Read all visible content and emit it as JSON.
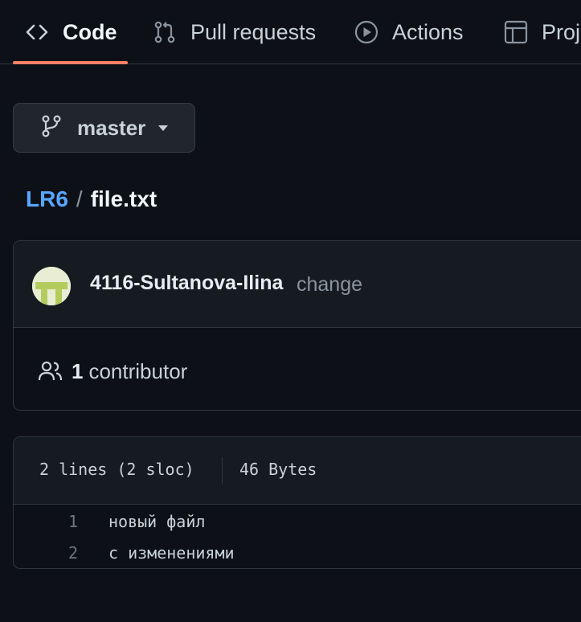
{
  "nav": {
    "tabs": [
      {
        "label": "Code",
        "icon": "code-icon",
        "active": true
      },
      {
        "label": "Pull requests",
        "icon": "pull-request-icon",
        "active": false
      },
      {
        "label": "Actions",
        "icon": "play-circle-icon",
        "active": false
      },
      {
        "label": "Proj",
        "icon": "table-icon",
        "active": false
      }
    ]
  },
  "branch": {
    "label": "master",
    "icon": "git-branch-icon"
  },
  "breadcrumb": {
    "repo": "LR6",
    "separator": "/",
    "file": "file.txt"
  },
  "commit": {
    "author": "4116-Sultanova-Ilina",
    "message": "change",
    "avatar_color": "#e8edd3",
    "avatar_mark_color": "#b4cc5e"
  },
  "contributors": {
    "count": "1",
    "label": "contributor"
  },
  "file": {
    "lines_info": "2 lines (2 sloc)",
    "size": "46 Bytes",
    "lines": [
      {
        "num": "1",
        "text": "новый файл"
      },
      {
        "num": "2",
        "text": "с изменениями"
      }
    ]
  },
  "colors": {
    "background": "#0d1117",
    "accent_underline": "#f78166",
    "link": "#58a6ff",
    "border": "#30363d"
  }
}
